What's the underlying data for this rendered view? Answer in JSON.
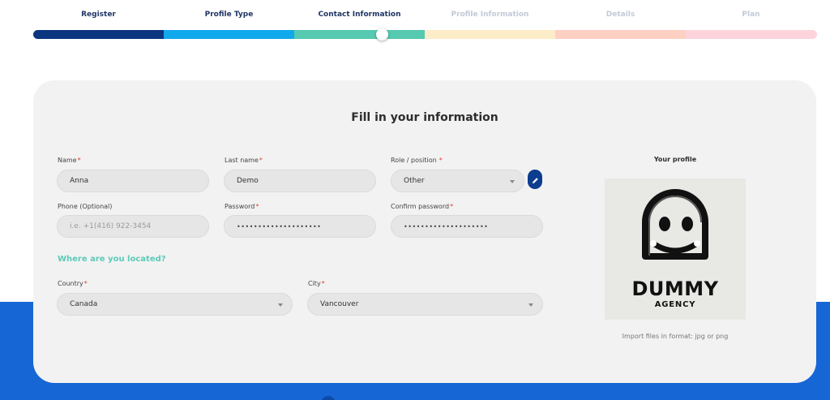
{
  "stepper": {
    "steps": [
      {
        "label": "Register",
        "state": "done",
        "color": "#0c3580"
      },
      {
        "label": "Profile Type",
        "state": "done",
        "color": "#11a9ec"
      },
      {
        "label": "Contact Information",
        "state": "current",
        "color": "#56c9b1"
      },
      {
        "label": "Profile Information",
        "state": "pending",
        "color": "#fdecc8"
      },
      {
        "label": "Details",
        "state": "pending",
        "color": "#fdd0c3"
      },
      {
        "label": "Plan",
        "state": "pending",
        "color": "#fdd3dc"
      }
    ],
    "current_step_progress": 0.67
  },
  "form": {
    "title": "Fill in your information",
    "name": {
      "label": "Name",
      "value": "Anna"
    },
    "last_name": {
      "label": "Last name",
      "value": "Demo"
    },
    "role": {
      "label": "Role / position",
      "value": "Other"
    },
    "phone": {
      "label": "Phone (Optional)",
      "placeholder": "i.e. +1(416) 922-3454"
    },
    "password": {
      "label": "Password",
      "value": "••••••••••••••••••••"
    },
    "confirm_password": {
      "label": "Confirm password",
      "value": "••••••••••••••••••••"
    },
    "location_heading": "Where are you located?",
    "country": {
      "label": "Country",
      "value": "Canada"
    },
    "city": {
      "label": "City",
      "value": "Vancouver"
    },
    "required_mark": "*"
  },
  "profile": {
    "title": "Your profile",
    "logo_text_line1": "DUMMY",
    "logo_text_line2": "AGENCY",
    "import_hint": "Import files in format: jpg or png"
  },
  "icons": {
    "edit": "pencil-icon",
    "dropdown": "chevron-down-icon"
  },
  "colors": {
    "accent_dark": "#0c3d8f",
    "accent_teal": "#5ccab8",
    "band_blue": "#1766d6",
    "required": "#e0402f"
  }
}
